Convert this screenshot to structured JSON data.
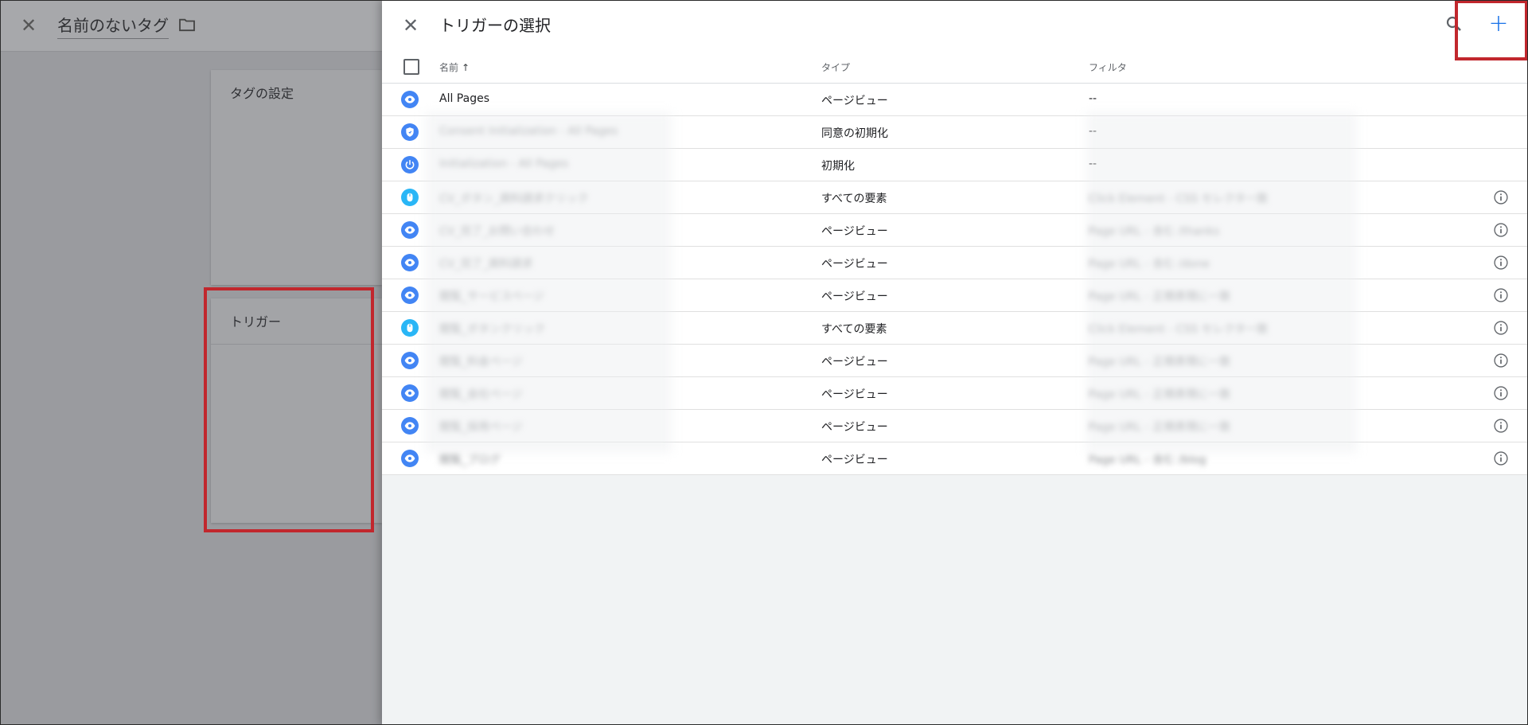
{
  "background": {
    "close_icon": "close-icon",
    "tag_title": "名前のないタグ",
    "folder_icon": "folder-icon",
    "tag_config_title": "タグの設定",
    "trigger_title": "トリガー"
  },
  "drawer": {
    "title": "トリガーの選択",
    "close_icon": "close-icon",
    "search_icon": "search-icon",
    "add_label": "+",
    "columns": {
      "name": "名前",
      "sort": "↑",
      "type": "タイプ",
      "filter": "フィルタ"
    },
    "rows": [
      {
        "name": "All Pages",
        "type": "ページビュー",
        "filter": "--",
        "icon": "eye-icon",
        "color": "#4285f4",
        "info": false
      },
      {
        "name": "Consent Initialization - All Pages",
        "type": "同意の初期化",
        "filter": "--",
        "icon": "shield-icon",
        "color": "#4285f4",
        "info": false
      },
      {
        "name": "Initialization - All Pages",
        "type": "初期化",
        "filter": "--",
        "icon": "power-icon",
        "color": "#4285f4",
        "info": false
      },
      {
        "name": "CV_ボタン_資料請求クリック",
        "type": "すべての要素",
        "filter": "Click Element - CSS セレクタ一致",
        "icon": "mouse-icon",
        "color": "#29b6f6",
        "info": true
      },
      {
        "name": "CV_完了_お問い合わせ",
        "type": "ページビュー",
        "filter": "Page URL - 含む /thanks",
        "icon": "eye-icon",
        "color": "#4285f4",
        "info": true
      },
      {
        "name": "CV_完了_資料請求",
        "type": "ページビュー",
        "filter": "Page URL - 含む /done",
        "icon": "eye-icon",
        "color": "#4285f4",
        "info": true
      },
      {
        "name": "閲覧_サービスページ",
        "type": "ページビュー",
        "filter": "Page URL - 正規表現に一致",
        "icon": "eye-icon",
        "color": "#4285f4",
        "info": true
      },
      {
        "name": "閲覧_ボタンクリック",
        "type": "すべての要素",
        "filter": "Click Element - CSS セレクタ一致",
        "icon": "mouse-icon",
        "color": "#29b6f6",
        "info": true
      },
      {
        "name": "閲覧_料金ページ",
        "type": "ページビュー",
        "filter": "Page URL - 正規表現に一致",
        "icon": "eye-icon",
        "color": "#4285f4",
        "info": true
      },
      {
        "name": "閲覧_会社ページ",
        "type": "ページビュー",
        "filter": "Page URL - 正規表現に一致",
        "icon": "eye-icon",
        "color": "#4285f4",
        "info": true
      },
      {
        "name": "閲覧_採用ページ",
        "type": "ページビュー",
        "filter": "Page URL - 正規表現に一致",
        "icon": "eye-icon",
        "color": "#4285f4",
        "info": true
      },
      {
        "name": "閲覧_ブログ",
        "type": "ページビュー",
        "filter": "Page URL - 含む /blog",
        "icon": "eye-icon",
        "color": "#4285f4",
        "info": true
      }
    ]
  },
  "colors": {
    "accent": "#1a73e8",
    "highlight": "#c1272d"
  }
}
